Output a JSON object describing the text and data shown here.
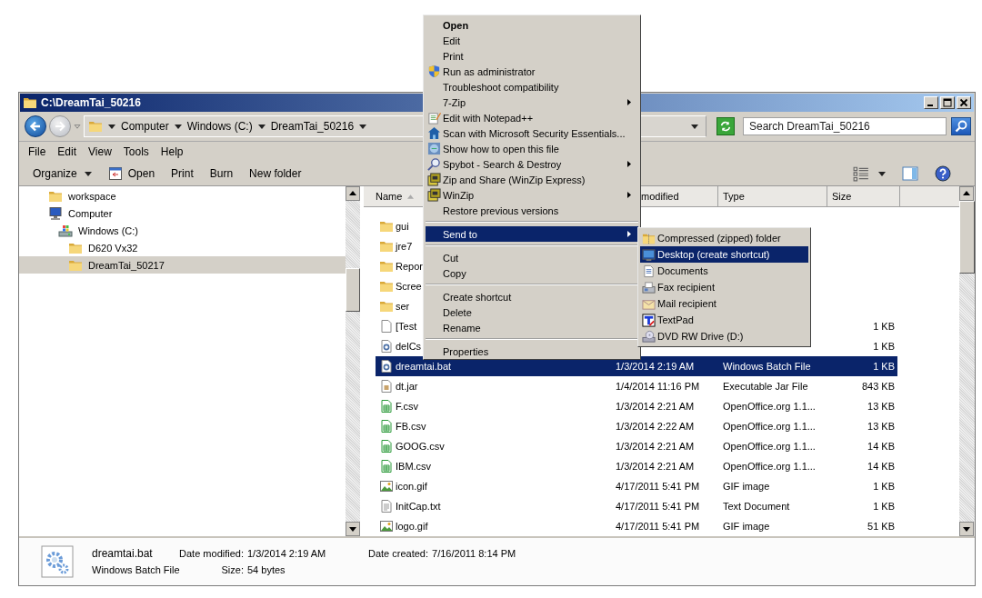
{
  "window": {
    "title": "C:\\DreamTai_50216"
  },
  "address": {
    "crumbs": [
      "Computer",
      "Windows (C:)",
      "DreamTai_50216"
    ]
  },
  "search": {
    "placeholder": "Search DreamTai_50216"
  },
  "menu_bar": [
    "File",
    "Edit",
    "View",
    "Tools",
    "Help"
  ],
  "toolbar": [
    {
      "label": "Organize",
      "kind": "dropdown"
    },
    {
      "label": "Open",
      "kind": "icon"
    },
    {
      "label": "Print",
      "kind": "plain"
    },
    {
      "label": "Burn",
      "kind": "plain"
    },
    {
      "label": "New folder",
      "kind": "plain"
    }
  ],
  "nav_tree": [
    {
      "label": "workspace",
      "kind": "folder",
      "selected": false
    },
    {
      "label": "Computer",
      "kind": "computer",
      "selected": false,
      "children": [
        {
          "label": "Windows (C:)",
          "kind": "drive",
          "selected": false,
          "children": [
            {
              "label": "D620 Vx32",
              "kind": "folder",
              "selected": false
            },
            {
              "label": "DreamTai_50217",
              "kind": "folder",
              "selected": true
            }
          ]
        }
      ]
    }
  ],
  "columns": [
    {
      "label": "Name",
      "sorted": true
    },
    {
      "label": "modified",
      "sorted": false
    },
    {
      "label": "Type",
      "sorted": false
    },
    {
      "label": "Size",
      "sorted": false
    }
  ],
  "files": [
    {
      "name": "gui",
      "kind": "folder",
      "selected": false
    },
    {
      "name": "jre7",
      "kind": "folder",
      "selected": false
    },
    {
      "name": "Repor",
      "kind": "folder",
      "selected": false
    },
    {
      "name": "Scree",
      "kind": "folder",
      "selected": false
    },
    {
      "name": "ser",
      "kind": "folder",
      "selected": false
    },
    {
      "name": "[Test",
      "kind": "file",
      "size": "1 KB",
      "selected": false
    },
    {
      "name": "delCs",
      "kind": "batch",
      "size": "1 KB",
      "selected": false
    },
    {
      "name": "dreamtai.bat",
      "kind": "batch",
      "date": "1/3/2014 2:19 AM",
      "type": "Windows Batch File",
      "size": "1 KB",
      "selected": true
    },
    {
      "name": "dt.jar",
      "kind": "jar",
      "date": "1/4/2014 11:16 PM",
      "type": "Executable Jar File",
      "size": "843 KB",
      "selected": false
    },
    {
      "name": "F.csv",
      "kind": "sheet",
      "date": "1/3/2014 2:21 AM",
      "type": "OpenOffice.org 1.1...",
      "size": "13 KB",
      "selected": false
    },
    {
      "name": "FB.csv",
      "kind": "sheet",
      "date": "1/3/2014 2:22 AM",
      "type": "OpenOffice.org 1.1...",
      "size": "13 KB",
      "selected": false
    },
    {
      "name": "GOOG.csv",
      "kind": "sheet",
      "date": "1/3/2014 2:21 AM",
      "type": "OpenOffice.org 1.1...",
      "size": "14 KB",
      "selected": false
    },
    {
      "name": "IBM.csv",
      "kind": "sheet",
      "date": "1/3/2014 2:21 AM",
      "type": "OpenOffice.org 1.1...",
      "size": "14 KB",
      "selected": false
    },
    {
      "name": "icon.gif",
      "kind": "image",
      "date": "4/17/2011 5:41 PM",
      "type": "GIF image",
      "size": "1 KB",
      "selected": false
    },
    {
      "name": "InitCap.txt",
      "kind": "text",
      "date": "4/17/2011 5:41 PM",
      "type": "Text Document",
      "size": "1 KB",
      "selected": false
    },
    {
      "name": "logo.gif",
      "kind": "image",
      "date": "4/17/2011 5:41 PM",
      "type": "GIF image",
      "size": "51 KB",
      "selected": false
    }
  ],
  "details": {
    "name": "dreamtai.bat",
    "type": "Windows Batch File",
    "fields": [
      {
        "label": "Date modified:",
        "value": "1/3/2014 2:19 AM"
      },
      {
        "label": "Size:",
        "value": "54 bytes"
      },
      {
        "label": "Date created:",
        "value": "7/16/2011 8:14 PM"
      }
    ]
  },
  "context_menu": {
    "items": [
      {
        "kind": "plain",
        "label": "Open",
        "default": true,
        "submenu": false,
        "selected": false
      },
      {
        "kind": "plain",
        "label": "Edit",
        "default": false,
        "submenu": false,
        "selected": false
      },
      {
        "kind": "plain",
        "label": "Print",
        "default": false,
        "submenu": false,
        "selected": false
      },
      {
        "kind": "shield",
        "label": "Run as administrator",
        "default": false,
        "submenu": false,
        "selected": false
      },
      {
        "kind": "plain",
        "label": "Troubleshoot compatibility",
        "default": false,
        "submenu": false,
        "selected": false
      },
      {
        "kind": "plain",
        "label": "7-Zip",
        "default": false,
        "submenu": true,
        "selected": false
      },
      {
        "kind": "notepad",
        "label": "Edit with Notepad++",
        "default": false,
        "submenu": false,
        "selected": false
      },
      {
        "kind": "scan",
        "label": "Scan with Microsoft Security Essentials...",
        "default": false,
        "submenu": false,
        "selected": false
      },
      {
        "kind": "show",
        "label": "Show how to open this file",
        "default": false,
        "submenu": false,
        "selected": false
      },
      {
        "kind": "spybot",
        "label": "Spybot - Search & Destroy",
        "default": false,
        "submenu": true,
        "selected": false
      },
      {
        "kind": "winzip",
        "label": "Zip and Share (WinZip Express)",
        "default": false,
        "submenu": false,
        "selected": false
      },
      {
        "kind": "winzip",
        "label": "WinZip",
        "default": false,
        "submenu": true,
        "selected": false
      },
      {
        "kind": "plain",
        "label": "Restore previous versions",
        "default": false,
        "submenu": false,
        "selected": false
      },
      {
        "kind": "separator"
      },
      {
        "kind": "plain",
        "label": "Send to",
        "default": false,
        "submenu": true,
        "selected": true
      },
      {
        "kind": "separator"
      },
      {
        "kind": "plain",
        "label": "Cut",
        "default": false,
        "submenu": false,
        "selected": false
      },
      {
        "kind": "plain",
        "label": "Copy",
        "default": false,
        "submenu": false,
        "selected": false
      },
      {
        "kind": "separator"
      },
      {
        "kind": "plain",
        "label": "Create shortcut",
        "default": false,
        "submenu": false,
        "selected": false
      },
      {
        "kind": "plain",
        "label": "Delete",
        "default": false,
        "submenu": false,
        "selected": false
      },
      {
        "kind": "plain",
        "label": "Rename",
        "default": false,
        "submenu": false,
        "selected": false
      },
      {
        "kind": "separator"
      },
      {
        "kind": "plain",
        "label": "Properties",
        "default": false,
        "submenu": false,
        "selected": false
      }
    ]
  },
  "send_to_menu": {
    "items": [
      {
        "label": "Compressed (zipped) folder",
        "kind": "zip",
        "selected": false
      },
      {
        "label": "Desktop (create shortcut)",
        "kind": "desktop",
        "selected": true
      },
      {
        "label": "Documents",
        "kind": "documents",
        "selected": false
      },
      {
        "label": "Fax recipient",
        "kind": "fax",
        "selected": false
      },
      {
        "label": "Mail recipient",
        "kind": "mail",
        "selected": false
      },
      {
        "label": "TextPad",
        "kind": "textpad",
        "selected": false
      },
      {
        "label": "DVD RW Drive (D:)",
        "kind": "dvd",
        "selected": false
      }
    ]
  }
}
